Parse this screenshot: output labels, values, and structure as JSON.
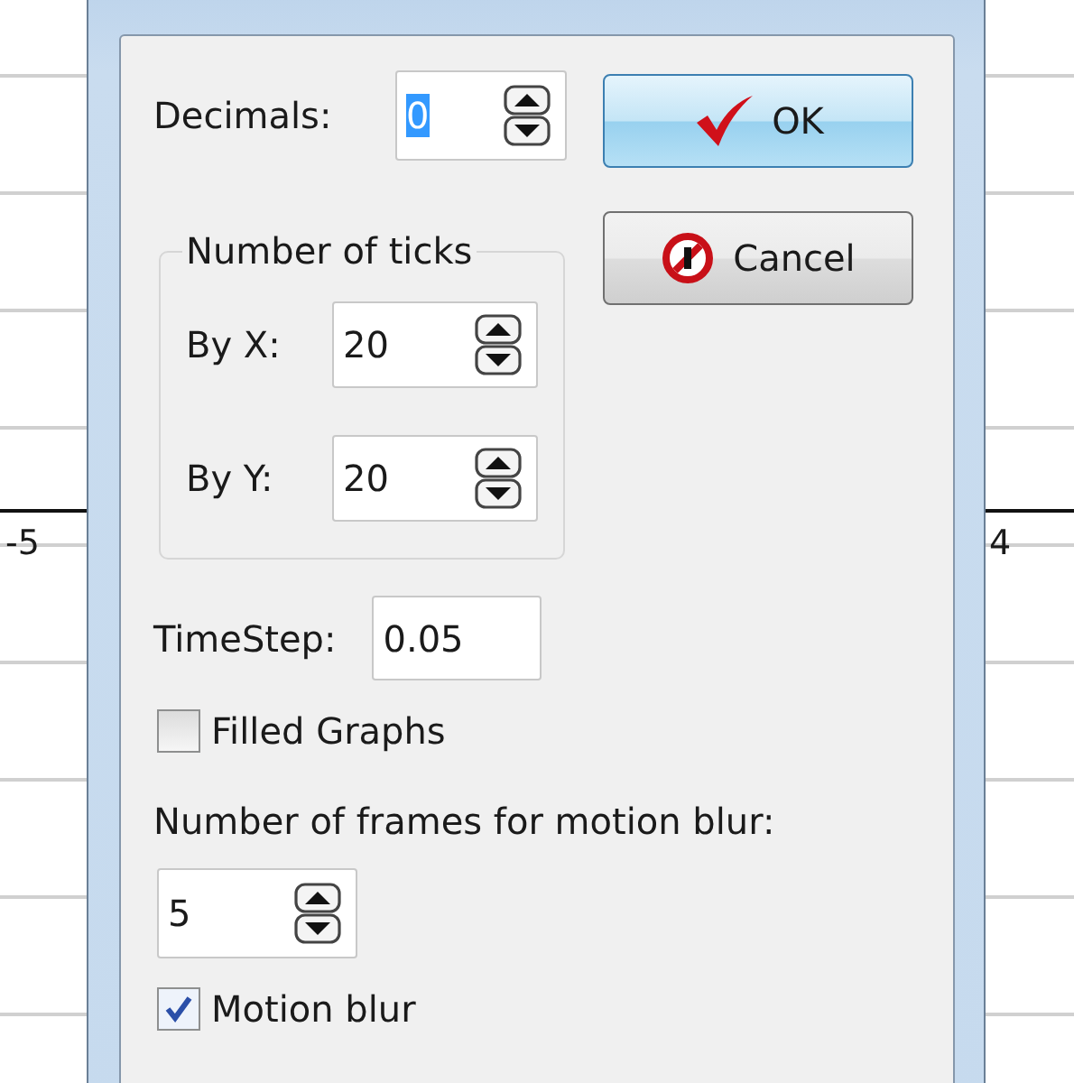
{
  "axis_labels": [
    "-5",
    "4"
  ],
  "dialog": {
    "decimals": {
      "label": "Decimals:",
      "value": "0",
      "selected": true
    },
    "buttons": [
      {
        "kind": "ok",
        "label": "OK"
      },
      {
        "kind": "cancel",
        "label": "Cancel"
      }
    ],
    "ticks_group": {
      "title": "Number of ticks",
      "fields": [
        {
          "label": "By X:",
          "value": "20"
        },
        {
          "label": "By Y:",
          "value": "20"
        }
      ]
    },
    "timestep": {
      "label": "TimeStep:",
      "value": "0.05"
    },
    "filled_graphs": {
      "label": "Filled Graphs",
      "checked": false
    },
    "frames": {
      "label": "Number of frames for motion blur:",
      "value": "5"
    },
    "motion_blur": {
      "label": "Motion blur",
      "checked": true
    }
  }
}
